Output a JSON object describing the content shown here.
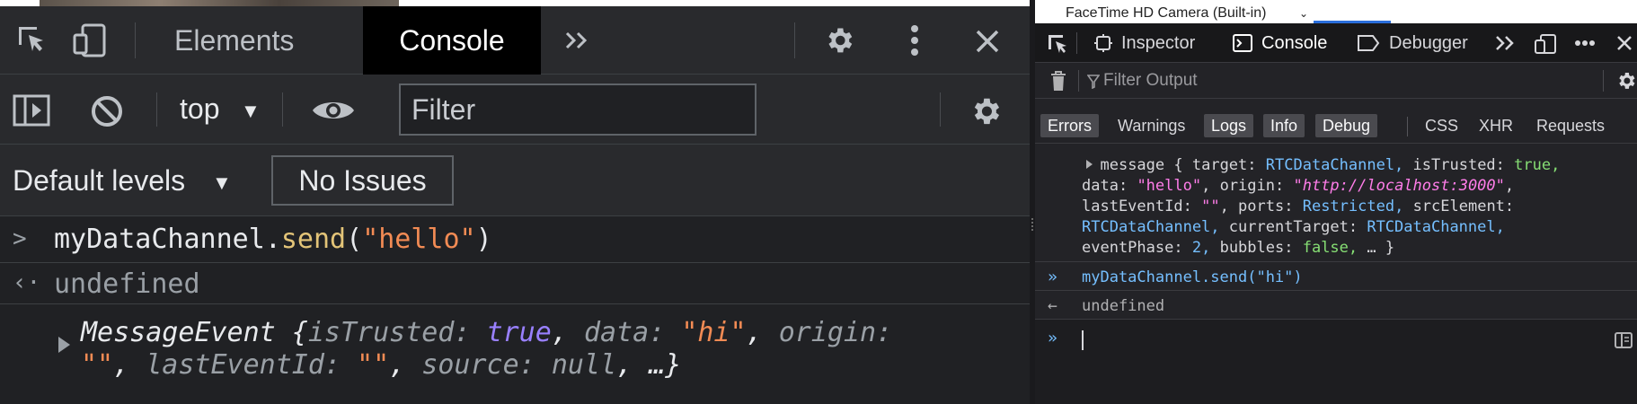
{
  "chrome": {
    "tabs": {
      "elements": "Elements",
      "console": "Console"
    },
    "context": "top",
    "filter_placeholder": "Filter",
    "levels": "Default levels",
    "issues": "No Issues",
    "log": {
      "cmd_object": "myDataChannel",
      "cmd_method": "send",
      "cmd_arg": "\"hello\"",
      "result": "undefined",
      "event": {
        "type": "MessageEvent",
        "k_istrusted": "isTrusted:",
        "v_istrusted": "true",
        "k_data": "data:",
        "v_data": "\"hi\"",
        "k_origin": "origin:",
        "v_origin": "\"\"",
        "k_lasteventid": "lastEventId:",
        "v_lasteventid": "\"\"",
        "k_source": "source:",
        "v_source": "null",
        "ellipsis": "…}"
      }
    }
  },
  "firefox": {
    "camera": "FaceTime HD Camera (Built-in)",
    "tabs": {
      "inspector": "Inspector",
      "console": "Console",
      "debugger": "Debugger"
    },
    "filter_placeholder": "Filter Output",
    "levels": {
      "errors": "Errors",
      "warnings": "Warnings",
      "logs": "Logs",
      "info": "Info",
      "debug": "Debug",
      "css": "CSS",
      "xhr": "XHR",
      "requests": "Requests"
    },
    "message": {
      "label": "message",
      "k_target": "target:",
      "v_target": "RTCDataChannel,",
      "k_istrusted": "isTrusted:",
      "v_istrusted": "true,",
      "k_data": "data:",
      "v_data": "\"hello\"",
      "k_origin": "origin:",
      "v_origin": "\"http://localhost:3000\"",
      "k_lasteventid": "lastEventId:",
      "v_lasteventid": "\"\"",
      "k_ports": "ports:",
      "v_ports": "Restricted,",
      "k_srcelement": "srcElement:",
      "v_srcelement": "RTCDataChannel,",
      "k_currenttarget": "currentTarget:",
      "v_currenttarget": "RTCDataChannel,",
      "k_eventphase": "eventPhase:",
      "v_eventphase": "2,",
      "k_bubbles": "bubbles:",
      "v_bubbles": "false,",
      "ellipsis": "… }"
    },
    "command": "myDataChannel.send(\"hi\")",
    "result": "undefined"
  },
  "colors": {
    "chrome_bg": "#202124",
    "chrome_toolbar": "#292a2d",
    "string": "#f28b54",
    "method": "#e3c478",
    "boolean": "#9980ff",
    "firefox_bg": "#232327",
    "firefox_blue": "#75bfff",
    "firefox_pink": "#ff7de9",
    "firefox_green": "#86de74"
  }
}
